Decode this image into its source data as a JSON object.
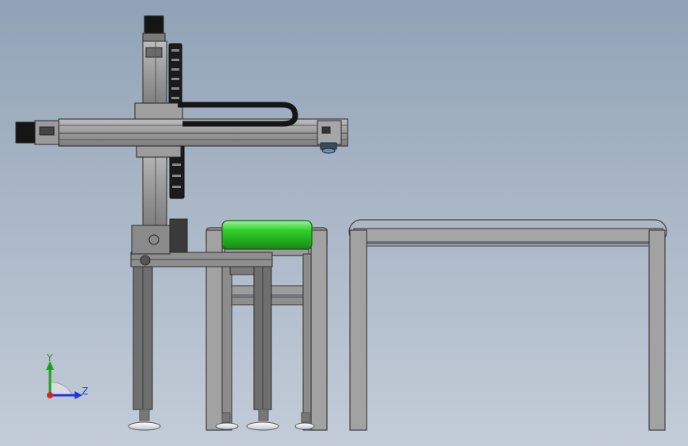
{
  "triad": {
    "y_label": "Y",
    "z_label": "Z"
  },
  "colors": {
    "frame": "#a2a2a2",
    "frame_dark": "#4d4d4d",
    "roller_green": "#2fd02a",
    "axis_y": "#17a317",
    "axis_z": "#2233dd",
    "axis_x": "#dd2222"
  }
}
